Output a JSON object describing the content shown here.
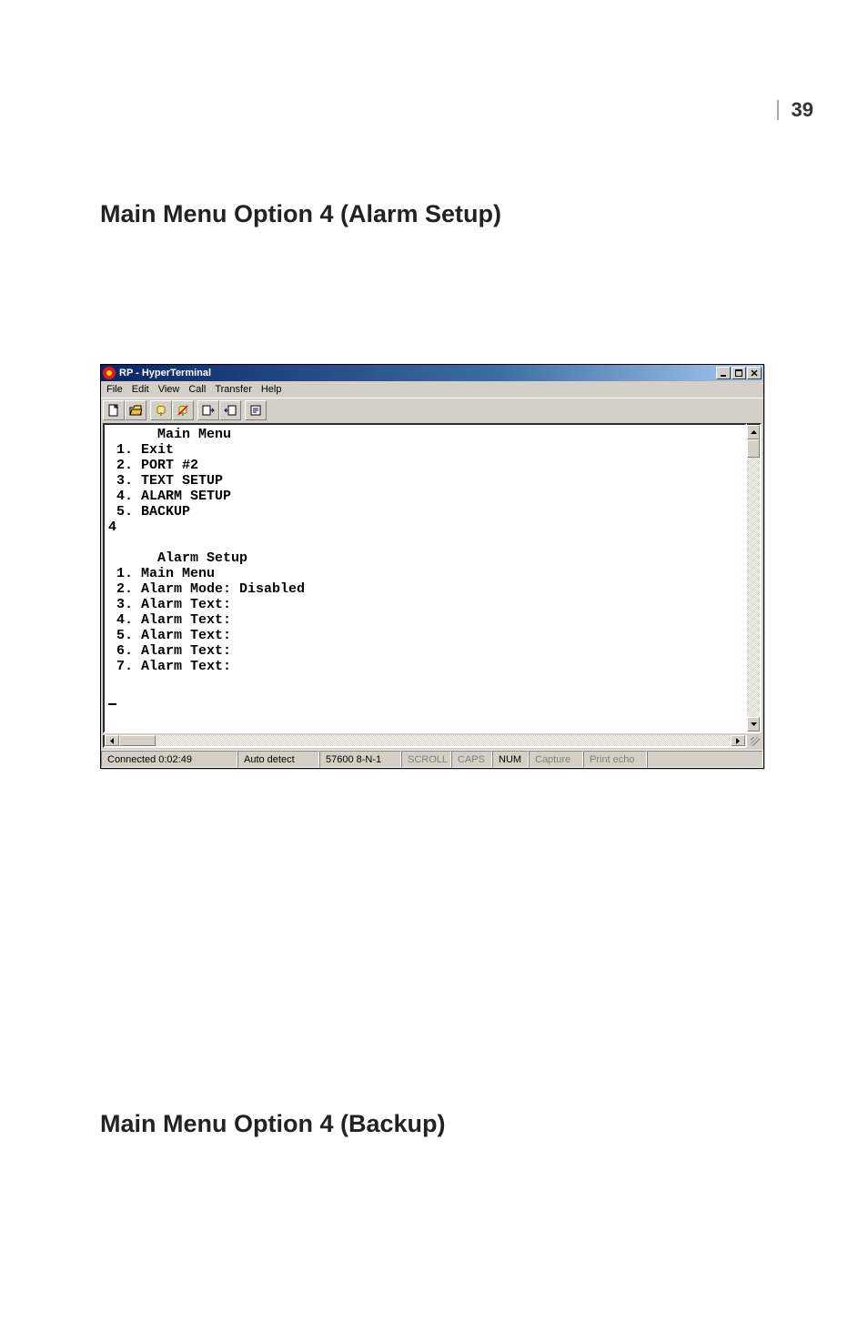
{
  "page_number": "39",
  "heading_alarm": "Main Menu Option 4 (Alarm Setup)",
  "heading_backup": "Main Menu Option 4 (Backup)",
  "window": {
    "title": "RP - HyperTerminal",
    "menus": [
      "File",
      "Edit",
      "View",
      "Call",
      "Transfer",
      "Help"
    ]
  },
  "terminal": {
    "main_menu_heading": "      Main Menu",
    "main_items": [
      " 1. Exit",
      " 2. PORT #2",
      " 3. TEXT SETUP",
      " 4. ALARM SETUP",
      " 5. BACKUP"
    ],
    "input_prompt": "4",
    "alarm_heading": "      Alarm Setup",
    "alarm_items": [
      " 1. Main Menu",
      " 2. Alarm Mode: Disabled",
      " 3. Alarm Text:",
      " 4. Alarm Text:",
      " 5. Alarm Text:",
      " 6. Alarm Text:",
      " 7. Alarm Text:"
    ]
  },
  "status": {
    "connected": "Connected 0:02:49",
    "detect": "Auto detect",
    "baud": "57600 8-N-1",
    "scroll": "SCROLL",
    "caps": "CAPS",
    "num": "NUM",
    "capture": "Capture",
    "echo": "Print echo"
  }
}
